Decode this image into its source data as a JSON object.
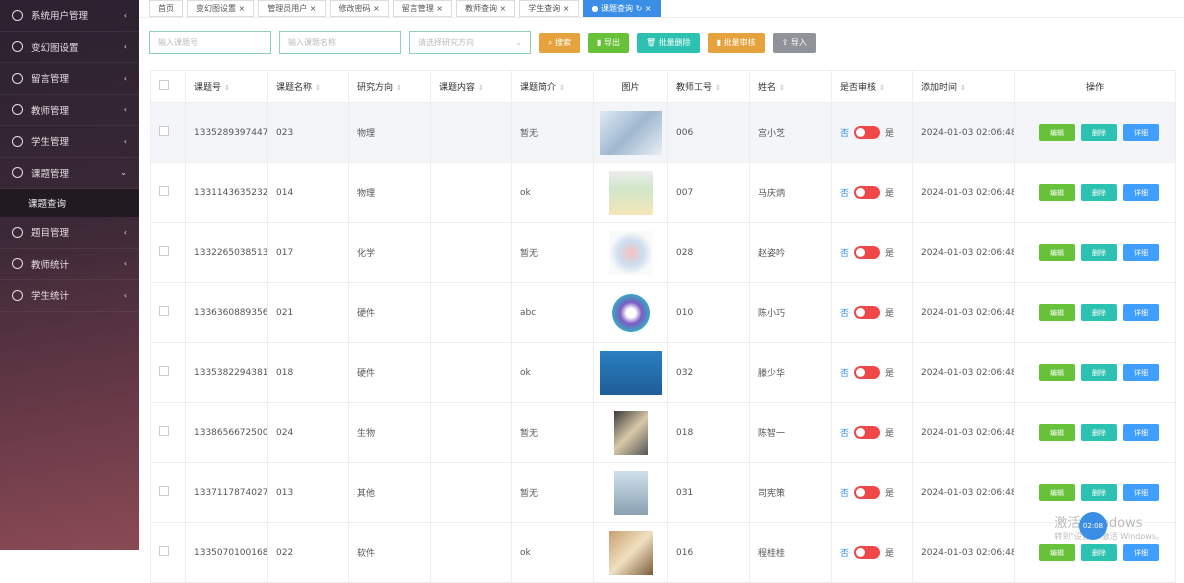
{
  "sidebar": {
    "items": [
      {
        "label": "系统用户管理"
      },
      {
        "label": "变幻图设置"
      },
      {
        "label": "留言管理"
      },
      {
        "label": "教师管理"
      },
      {
        "label": "学生管理"
      },
      {
        "label": "课题管理",
        "expanded": true
      },
      {
        "label": "题目管理"
      },
      {
        "label": "教师统计"
      },
      {
        "label": "学生统计"
      }
    ],
    "sub": "课题查询"
  },
  "tabs": [
    "首页",
    "变幻图设置",
    "管理员用户",
    "修改密码",
    "留言管理",
    "教师查询",
    "学生查询",
    "课题查询"
  ],
  "search": {
    "p1": "输入课题号",
    "p2": "输入课题名称",
    "p3": "请选择研究方向",
    "btns": [
      "搜索",
      "导出",
      "批量删除",
      "批量审核",
      "导入"
    ]
  },
  "columns": [
    "课题号",
    "课题名称",
    "研究方向",
    "课题内容",
    "课题简介",
    "图片",
    "教师工号",
    "姓名",
    "是否审核",
    "添加时间",
    "操作"
  ],
  "toggle": {
    "no": "否",
    "yes": "是"
  },
  "ops": [
    "编辑",
    "删除",
    "详细"
  ],
  "rows": [
    [
      "1335289397447",
      "023",
      "物理",
      "",
      "暂无",
      "006",
      "宫小芝",
      "2024-01-03 02:06:48"
    ],
    [
      "1331143635232",
      "014",
      "物理",
      "",
      "ok",
      "007",
      "马庆炳",
      "2024-01-03 02:06:48"
    ],
    [
      "1332265038513",
      "017",
      "化学",
      "",
      "暂无",
      "028",
      "赵姿吟",
      "2024-01-03 02:06:48"
    ],
    [
      "1336360889356",
      "021",
      "硬件",
      "",
      "abc",
      "010",
      "陈小巧",
      "2024-01-03 02:06:48"
    ],
    [
      "1335382294381",
      "018",
      "硬件",
      "",
      "ok",
      "032",
      "滕少华",
      "2024-01-03 02:06:48"
    ],
    [
      "1338656672500",
      "024",
      "生物",
      "",
      "暂无",
      "018",
      "陈智一",
      "2024-01-03 02:06:48"
    ],
    [
      "1337117874027",
      "013",
      "其他",
      "",
      "暂无",
      "031",
      "司宪策",
      "2024-01-03 02:06:48"
    ],
    [
      "1335070100168",
      "022",
      "软件",
      "",
      "ok",
      "016",
      "程桂桂",
      "2024-01-03 02:06:48"
    ]
  ],
  "watermark": {
    "line1": "激活 Windows",
    "line2": "转到\"设置\"以激活 Windows。"
  },
  "fab": "02:08"
}
